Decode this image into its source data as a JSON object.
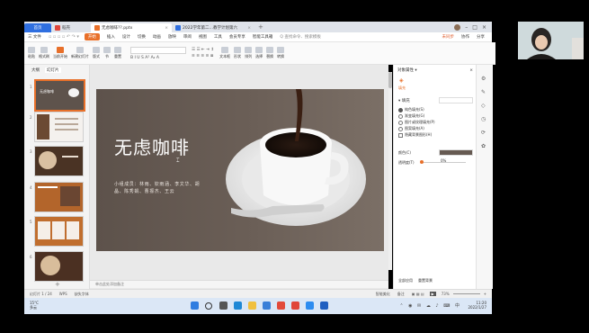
{
  "tabs": [
    {
      "label": "首页"
    },
    {
      "label": "稻壳"
    },
    {
      "label": "无虑咖啡??.pptx"
    },
    {
      "label": "2022学年第二…教学计划第六"
    }
  ],
  "menu": {
    "file": "三 文件",
    "items": [
      "开始",
      "插入",
      "设计",
      "切换",
      "动画",
      "放映",
      "审阅",
      "视图",
      "工具",
      "会员专享",
      "智能工具箱"
    ],
    "search": "Q 查找命令、搜索模板",
    "unsaved": "未同步",
    "collab": "协作",
    "share": "分享"
  },
  "ribbon": [
    "粘贴",
    "格式刷",
    "当前开始",
    "新建幻灯片",
    "版式",
    "节",
    "重置",
    "字体",
    "段落",
    "文本框",
    "形状",
    "排列",
    "选择",
    "替换",
    "转换"
  ],
  "thumbs_header": {
    "outline": "大纲",
    "slides": "幻灯片"
  },
  "slide_numbers": [
    "1",
    "2",
    "3",
    "4",
    "5",
    "6"
  ],
  "slide": {
    "title": "无虑咖啡",
    "body": "小组成员：林雨、钦雨涵、李文华、胡晶、陈秀娟、曹振杰、王云"
  },
  "right_panel": {
    "title": "对象属性 ▾",
    "tab": "填充",
    "section": "▾ 填充",
    "options": [
      "纯色填充(S)",
      "渐变填充(G)",
      "图片或纹理填充(P)",
      "图案填充(A)",
      "隐藏背景图形(H)"
    ],
    "color_label": "颜色(C)",
    "transparency_label": "透明度(T)",
    "transparency_value": "0%",
    "apply_all": "全部应用",
    "reset": "重置背景"
  },
  "notes_placeholder": "单击此处添加备注",
  "status": {
    "slide_pos": "幻灯片 1 / 24",
    "theme": "WPS",
    "font_missing": "缺失字体",
    "smart_beautify": "智能美化",
    "notes": "备注",
    "zoom": "73%"
  },
  "taskbar": {
    "weather_temp": "15°C",
    "weather_desc": "多云",
    "time": "11:20",
    "date": "2022/1/27"
  },
  "colors": {
    "accent": "#e8702a",
    "home_tab": "#2f6fe0",
    "slide_bg": "#665a52"
  }
}
